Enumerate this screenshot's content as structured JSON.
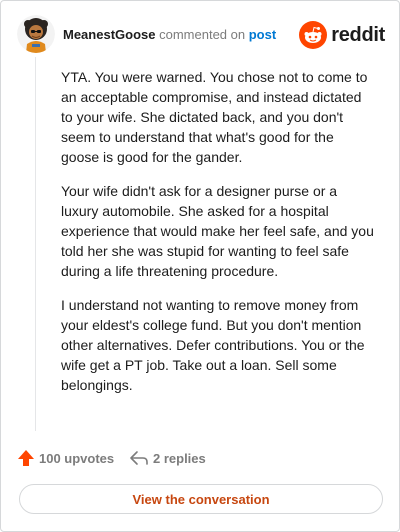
{
  "header": {
    "username": "MeanestGoose",
    "action_text": "commented on",
    "post_link": "post",
    "brand": "reddit"
  },
  "comment": {
    "paragraphs": [
      "YTA. You were warned. You chose not to come to an acceptable compromise, and instead dictated to your wife. She dictated back, and you don't seem to understand that what's good for the goose is good for the gander.",
      "Your wife didn't ask for a designer purse or a luxury automobile. She asked for a hospital experience that would make her feel safe, and you told her she was stupid for wanting to feel safe during a life threatening procedure.",
      "I understand not wanting to remove money from your eldest's college fund. But you don't mention other alternatives. Defer contributions. You or the wife get a PT job. Take out a loan. Sell some belongings."
    ]
  },
  "footer": {
    "upvotes": "100 upvotes",
    "replies": "2 replies",
    "cta": "View the conversation"
  },
  "icons": {
    "upvote": "upvote-arrow-icon",
    "reply": "reply-arrow-icon",
    "brand": "reddit-snoo-icon"
  },
  "colors": {
    "brand_orange": "#ff4500",
    "link_blue": "#0079d3",
    "cta_text": "#c74710",
    "muted": "#7c7c7c"
  }
}
